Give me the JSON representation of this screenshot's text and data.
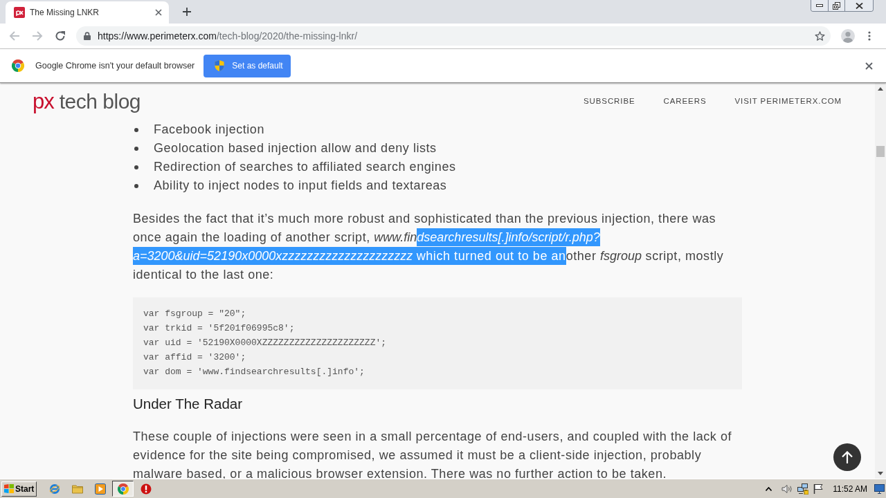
{
  "browser": {
    "tabs": [
      {
        "title": "The Missing LNKR",
        "selected": true
      }
    ],
    "navigation": [
      {
        "kind": "back",
        "disabled": true
      },
      {
        "kind": "forward",
        "disabled": true
      },
      {
        "kind": "reload",
        "disabled": false
      }
    ],
    "url": {
      "origin": "https://www.perimeterx.com",
      "path": "/tech-blog/2020/the-missing-lnkr/"
    }
  },
  "infobar": {
    "message": "Google Chrome isn't your default browser",
    "button": "Set as default"
  },
  "site_header": {
    "logo_mark": "px",
    "logo_text": "tech blog",
    "nav": [
      "SUBSCRIBE",
      "CAREERS",
      "VISIT PERIMETERX.COM"
    ]
  },
  "article": {
    "bullets": [
      "Facebook injection",
      "Geolocation based injection allow and deny lists",
      "Redirection of searches to affiliated search engines",
      "Ability to inject nodes to input fields and textareas"
    ],
    "paragraph": [
      {
        "text": "Besides the fact that it’s much more robust and sophisticated than the previous injection, there was once again the loading of another script, *www.fin*",
        "selected": false
      },
      {
        "text": "*dsearchresults[.]info/script/r.php?a=3200&uid=52190x0000xzzzzzzzzzzzzzzzzzzzzz* which turned out to be an",
        "selected": true
      },
      {
        "text": "other *fsgroup* script, mostly identical to the last one:",
        "selected": false
      }
    ],
    "code": [
      "var fsgroup = \"20\";",
      "var trkid = '5f201f06995c8';",
      "var uid = '52190X0000XZZZZZZZZZZZZZZZZZZZZZ';",
      "var affid = '3200';",
      "var dom = 'www.findsearchresults[.]info';"
    ],
    "heading": "Under The Radar",
    "paragraph_2": "These couple of injections were seen in a small percentage of end-users, and coupled with the lack of evidence for the site being compromised, we assumed it must be a client-side injection, probably malware based, or a malicious browser extension. There was no further action to be taken."
  },
  "taskbar": {
    "start": "Start",
    "apps": [
      {
        "kind": "globe",
        "selected": false
      },
      {
        "kind": "folder",
        "selected": false
      },
      {
        "kind": "player",
        "selected": false
      },
      {
        "kind": "chrome",
        "selected": true
      },
      {
        "kind": "alert",
        "selected": false
      }
    ],
    "clock": "11:52 AM"
  }
}
